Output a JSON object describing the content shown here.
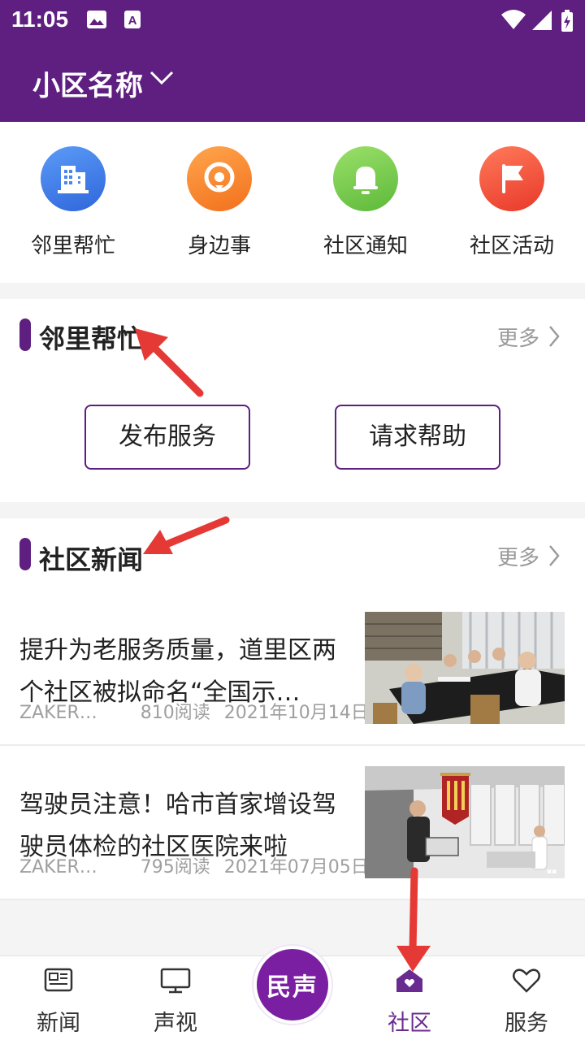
{
  "status": {
    "time": "11:05"
  },
  "header": {
    "title": "小区名称"
  },
  "quick_actions": [
    {
      "label": "邻里帮忙",
      "icon": "building-icon",
      "color": "#3a78e8"
    },
    {
      "label": "身边事",
      "icon": "location-icon",
      "color": "#f77d23"
    },
    {
      "label": "社区通知",
      "icon": "bell-icon",
      "color": "#74c84f"
    },
    {
      "label": "社区活动",
      "icon": "flag-icon",
      "color": "#ef4b36"
    }
  ],
  "neighbor_section": {
    "title": "邻里帮忙",
    "more": "更多",
    "buttons": [
      "发布服务",
      "请求帮助"
    ]
  },
  "news_section": {
    "title": "社区新闻",
    "more": "更多",
    "items": [
      {
        "title": "提升为老服务质量，道里区两个社区被拟命名“全国示…",
        "source": "ZAKER…",
        "reads": "810阅读",
        "date": "2021年10月14日"
      },
      {
        "title": "驾驶员注意！哈市首家增设驾驶员体检的社区医院来啦",
        "source": "ZAKER…",
        "reads": "795阅读",
        "date": "2021年07月05日"
      }
    ]
  },
  "tabbar": {
    "tabs": [
      {
        "label": "新闻",
        "icon": "newspaper-icon"
      },
      {
        "label": "声视",
        "icon": "monitor-icon"
      },
      {
        "label": "社区",
        "icon": "home-heart-icon",
        "active": true
      },
      {
        "label": "服务",
        "icon": "heart-icon"
      }
    ],
    "center_label": "民声"
  },
  "colors": {
    "primary": "#5e1f80",
    "active_tab": "#6a2b91",
    "annotation_arrow": "#e53935"
  }
}
